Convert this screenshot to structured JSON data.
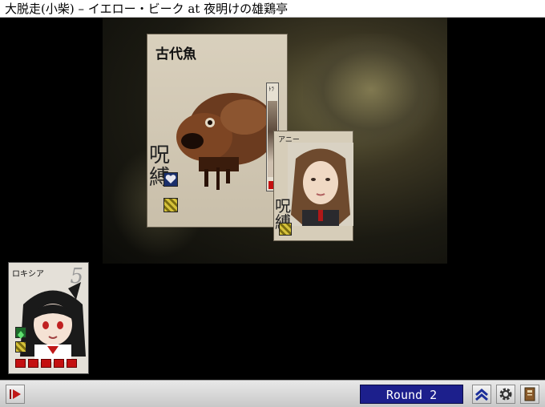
{
  "window": {
    "title": "大脱走(小柴) – イエロー・ビーク at 夜明けの雄鶏亭"
  },
  "enemy_card": {
    "name": "古代魚",
    "status_kanji": [
      "呪",
      "縛"
    ]
  },
  "party_strip": {
    "label": "ﾄﾗ"
  },
  "ally_card": {
    "name": "アニー",
    "status_kanji": [
      "呪",
      "縛"
    ]
  },
  "player_card": {
    "name": "ロキシア",
    "level": "5",
    "hp_blocks": 5
  },
  "toolbar": {
    "round_label": "Round 2"
  },
  "icons": {
    "play": "play-icon",
    "chevron": "double-chevron-up-icon",
    "settings": "gear-icon",
    "book": "book-icon"
  },
  "colors": {
    "round_bg": "#1c1f8c",
    "hp": "#c41010",
    "accent_red": "#c41010"
  }
}
